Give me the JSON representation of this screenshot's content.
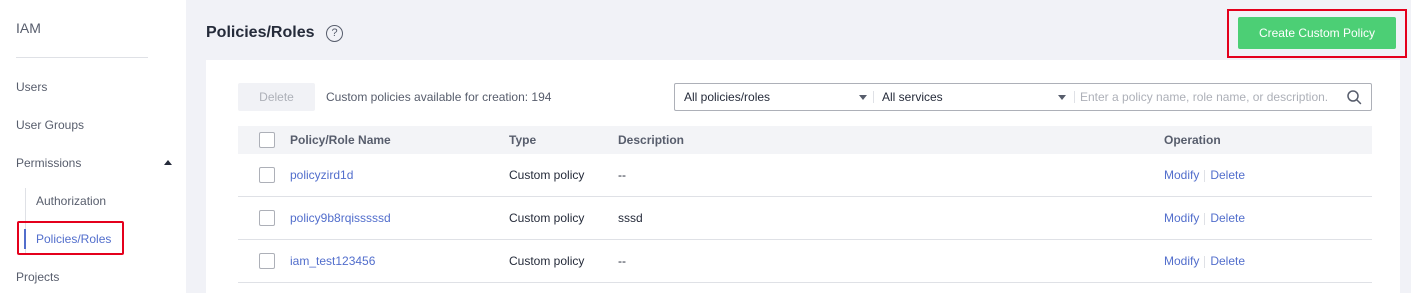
{
  "sidebar": {
    "title": "IAM",
    "items": {
      "users": "Users",
      "user_groups": "User Groups",
      "permissions": "Permissions",
      "authorization": "Authorization",
      "policies_roles": "Policies/Roles",
      "projects": "Projects"
    }
  },
  "header": {
    "title": "Policies/Roles",
    "help_icon": "?",
    "create_button": "Create Custom Policy"
  },
  "toolbar": {
    "delete_label": "Delete",
    "quota_text": "Custom policies available for creation: 194",
    "filter_type": "All policies/roles",
    "filter_service": "All services",
    "search_placeholder": "Enter a policy name, role name, or description."
  },
  "table": {
    "columns": [
      "Policy/Role Name",
      "Type",
      "Description",
      "Operation"
    ],
    "rows": [
      {
        "name": "policyzird1d",
        "type": "Custom policy",
        "description": "--",
        "modify": "Modify",
        "delete": "Delete"
      },
      {
        "name": "policy9b8rqisssssd",
        "type": "Custom policy",
        "description": "sssd",
        "modify": "Modify",
        "delete": "Delete"
      },
      {
        "name": "iam_test123456",
        "type": "Custom policy",
        "description": "--",
        "modify": "Modify",
        "delete": "Delete"
      }
    ]
  },
  "colors": {
    "accent": "#526ecc",
    "primary_button": "#4ccf75",
    "highlight_border": "#e4001c",
    "page_background": "#f1f2f7"
  },
  "icons": [
    "help-icon",
    "caret-up-icon",
    "caret-down-icon",
    "search-icon"
  ]
}
